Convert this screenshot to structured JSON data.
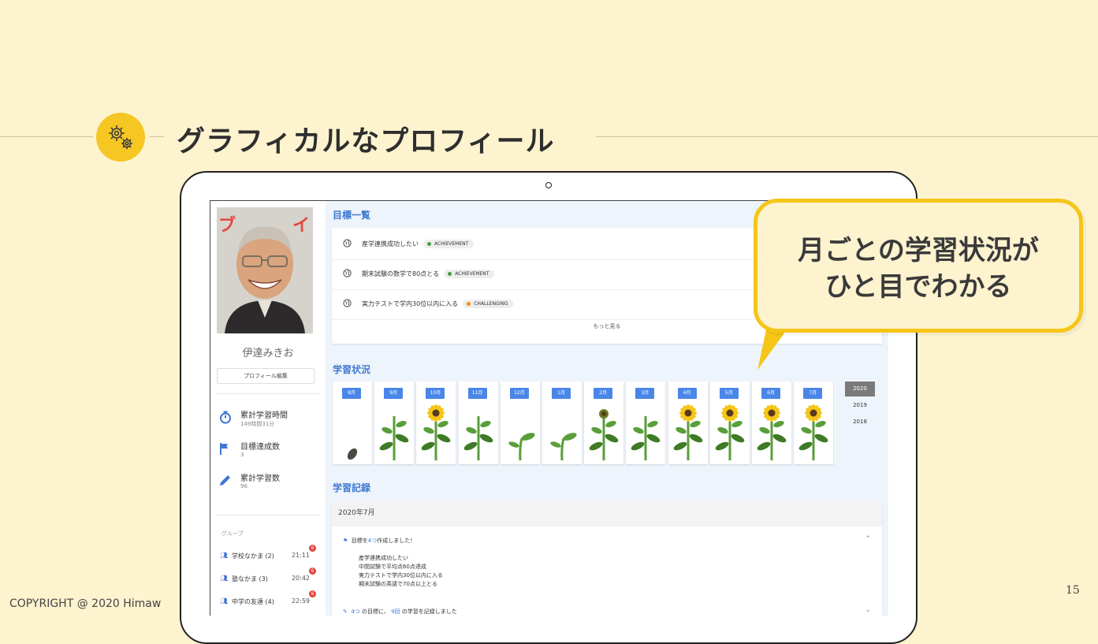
{
  "slide": {
    "title": "グラフィカルなプロフィール",
    "copyright": "COPYRIGHT @ 2020 Himaw",
    "page_number": "15",
    "callout_line1": "月ごとの学習状況が",
    "callout_line2": "ひと目でわかる"
  },
  "profile": {
    "name": "伊達みきお",
    "edit_button": "プロフィール編集",
    "stats": [
      {
        "label": "累計学習時間",
        "value": "149時間31分",
        "icon": "timer-icon"
      },
      {
        "label": "目標達成数",
        "value": "3",
        "icon": "flag-icon"
      },
      {
        "label": "累計学習数",
        "value": "96",
        "icon": "pencil-icon"
      }
    ],
    "groups_header": "グループ",
    "groups": [
      {
        "name": "学校なかま (2)",
        "time": "21:11",
        "badge": "6"
      },
      {
        "name": "塾なかま (3)",
        "time": "20:42",
        "badge": "6"
      },
      {
        "name": "中学の友達 (4)",
        "time": "22:59",
        "badge": "6"
      }
    ]
  },
  "goals": {
    "title": "目標一覧",
    "items": [
      {
        "text": "産学連携成功したい",
        "status": "ACHIEVEMENT",
        "status_color": "#43a047"
      },
      {
        "text": "期末試験の数学で80点とる",
        "status": "ACHIEVEMENT",
        "status_color": "#43a047"
      },
      {
        "text": "実力テストで学内30位以内に入る",
        "status": "CHALLENGING",
        "status_color": "#fb8c00"
      }
    ],
    "more": "もっと見る"
  },
  "study_status": {
    "title": "学習状況",
    "months": [
      {
        "label": "8月",
        "stage": "seed"
      },
      {
        "label": "9月",
        "stage": "leaves"
      },
      {
        "label": "10月",
        "stage": "flower"
      },
      {
        "label": "11月",
        "stage": "leaves"
      },
      {
        "label": "12月",
        "stage": "sprout"
      },
      {
        "label": "1月",
        "stage": "sprout"
      },
      {
        "label": "2月",
        "stage": "bud"
      },
      {
        "label": "3月",
        "stage": "leaves"
      },
      {
        "label": "4月",
        "stage": "flower"
      },
      {
        "label": "5月",
        "stage": "flower"
      },
      {
        "label": "6月",
        "stage": "flower"
      },
      {
        "label": "7月",
        "stage": "flower"
      }
    ],
    "years": [
      "2020",
      "2019",
      "2018"
    ],
    "selected_year": "2020"
  },
  "records": {
    "title": "学習記録",
    "month_header": "2020年7月",
    "item1_prefix": "目標を",
    "item1_count": "4つ",
    "item1_suffix": "作成しました！",
    "item1_lines": [
      "産学連携成功したい",
      "中間試験で平均点60点達成",
      "実力テストで学内30位以内に入る",
      "期末試験の英語で70点以上とる"
    ],
    "item2_count1": "4つ",
    "item2_mid": "の目標に、",
    "item2_count2": "9回",
    "item2_suffix": "の学習を記録しました"
  }
}
